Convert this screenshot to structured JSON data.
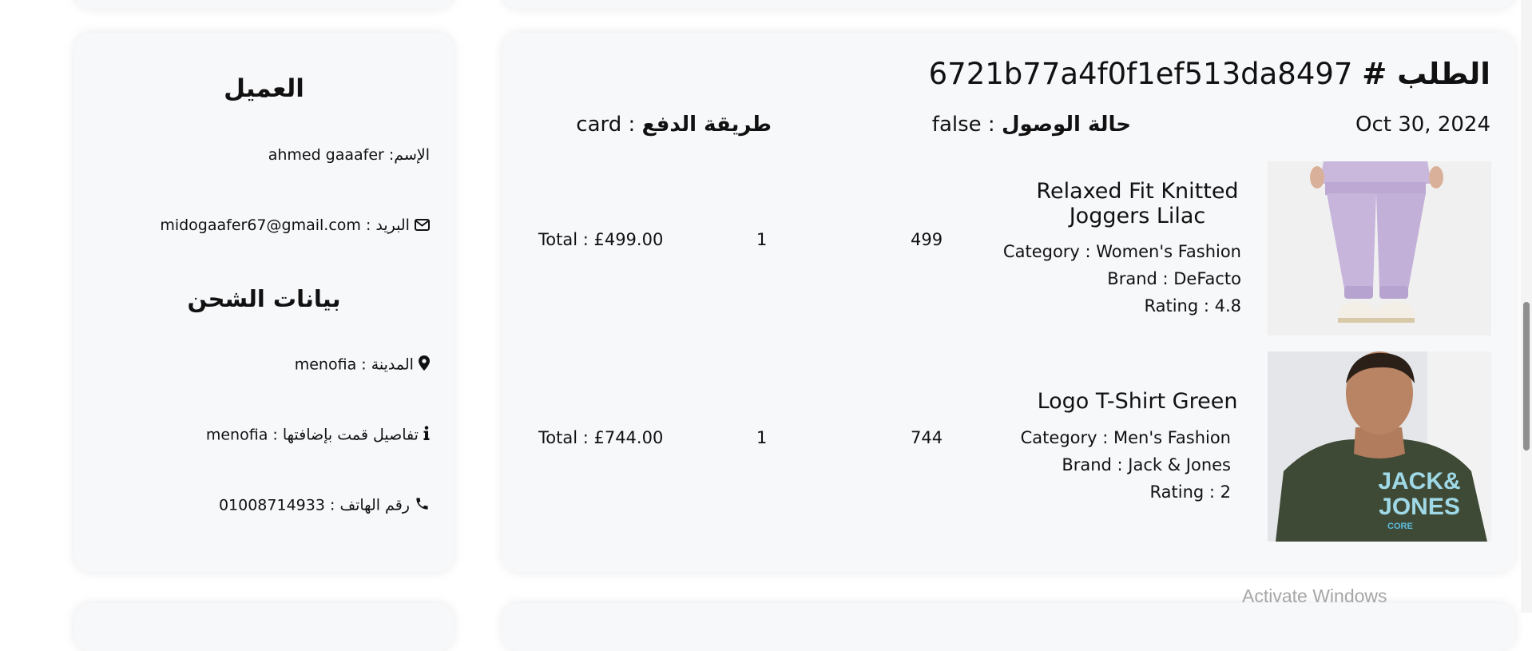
{
  "customer": {
    "heading": "العميل",
    "name_label": "الإسم:",
    "name_value": "ahmed gaaafer",
    "email_label": "البريد",
    "email_value": "midogaafer67@gmail.com",
    "email_sep": " : ",
    "shipping_heading": "بيانات الشحن",
    "city_label": "المدينة",
    "city_value": "menofia",
    "details_label": "تفاصيل قمت بإضافتها",
    "details_value": "menofia",
    "phone_label": "رقم الهاتف",
    "phone_value": "01008714933",
    "sep": " : "
  },
  "order": {
    "title_label": "الطلب #",
    "order_id": "6721b77a4f0f1ef513da8497",
    "date": "Oct 30, 2024",
    "delivery_label": "حالة الوصول",
    "delivery_value": "false",
    "payment_label": "طريقة الدفع",
    "payment_value": "card",
    "sep": " : ",
    "items": [
      {
        "name": "Relaxed Fit Knitted Joggers Lilac",
        "category": "Category : Women's Fashion",
        "brand": "Brand : DeFacto",
        "rating": "Rating : 4.8",
        "price": "499",
        "quantity": "1",
        "total": "Total : £499.00"
      },
      {
        "name": "Logo T-Shirt Green",
        "category": "Category : Men's Fashion",
        "brand": "Brand : Jack & Jones",
        "rating": "Rating : 2",
        "price": "744",
        "quantity": "1",
        "total": "Total : £744.00",
        "image_text_line1": "JACK&",
        "image_text_line2": "JONES",
        "image_text_line3": "CORE"
      }
    ]
  },
  "system": {
    "watermark": "Activate Windows"
  },
  "icons": {
    "email": "envelope-icon",
    "city": "map-marker-icon",
    "details": "info-icon",
    "phone": "phone-icon"
  }
}
